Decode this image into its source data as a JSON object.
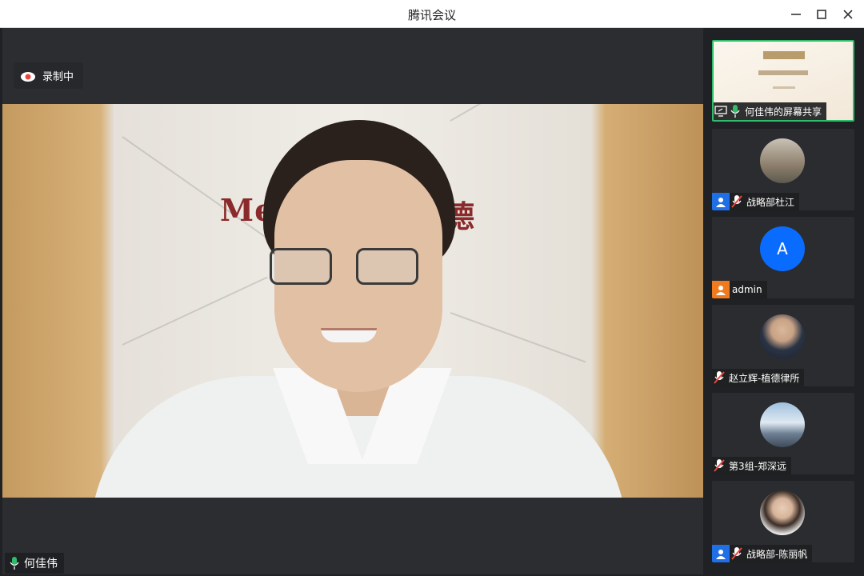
{
  "window": {
    "title": "腾讯会议"
  },
  "recording": {
    "label": "录制中"
  },
  "main_video": {
    "speaker_name": "何佳伟",
    "wall_text_left": "Me",
    "wall_text_right": "德"
  },
  "participants": [
    {
      "name": "何佳伟的屏幕共享",
      "type": "screen-share",
      "mic": "on"
    },
    {
      "name": "战略部杜江",
      "type": "photo",
      "mic": "muted",
      "badge": "blue-user"
    },
    {
      "name": "admin",
      "type": "letter",
      "letter": "A",
      "mic": "none",
      "badge": "orange-user"
    },
    {
      "name": "赵立辉-植德律所",
      "type": "photo",
      "mic": "muted"
    },
    {
      "name": "第3组-郑深远",
      "type": "photo",
      "mic": "muted"
    },
    {
      "name": "战略部-陈丽帆",
      "type": "photo",
      "mic": "muted",
      "badge": "blue-user"
    }
  ],
  "colors": {
    "accent_green": "#2ebd6b",
    "avatar_blue": "#0a6cff",
    "badge_blue": "#1e6fe8",
    "badge_orange": "#f07a1e",
    "mute_red": "#e8473e"
  }
}
